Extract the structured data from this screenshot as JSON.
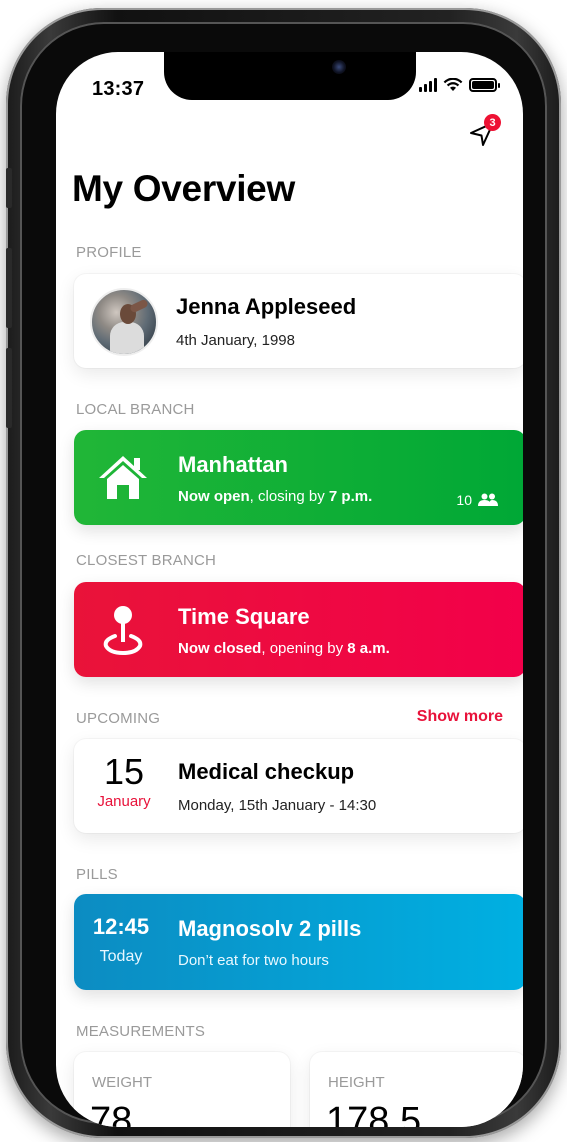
{
  "status_bar": {
    "time": "13:37"
  },
  "notifications": {
    "badge_count": "3"
  },
  "page": {
    "title": "My Overview"
  },
  "sections": {
    "profile": "PROFILE",
    "local_branch": "LOCAL BRANCH",
    "closest_branch": "CLOSEST BRANCH",
    "upcoming": "UPCOMING",
    "upcoming_action": "Show more",
    "pills": "PILLS",
    "measurements": "MEASUREMENTS"
  },
  "profile": {
    "name": "Jenna Appleseed",
    "birthdate": "4th January, 1998"
  },
  "local_branch": {
    "name": "Manhattan",
    "status_bold": "Now open",
    "status_mid": ", closing by ",
    "status_time": "7 p.m.",
    "visitors": "10",
    "color_start": "#1fb534",
    "color_end": "#00a834"
  },
  "closest_branch": {
    "name": "Time Square",
    "status_bold": "Now closed",
    "status_mid": ", opening by ",
    "status_time": "8 a.m.",
    "color_start": "#e8123a",
    "color_end": "#f10048"
  },
  "upcoming": {
    "day": "15",
    "month": "January",
    "title": "Medical checkup",
    "detail": "Monday, 15th January - 14:30"
  },
  "pills": {
    "time": "12:45",
    "day": "Today",
    "title": "Magnosolv 2 pills",
    "note": "Don’t eat for two hours",
    "color_start": "#0d8fc4",
    "color_end": "#00aee0"
  },
  "measurements": {
    "weight_label": "WEIGHT",
    "weight_value": "78",
    "height_label": "HEIGHT",
    "height_value": "178.5"
  },
  "icons": {
    "notification": "paper-plane-icon",
    "home": "house-icon",
    "location": "map-pin-icon",
    "people": "people-icon"
  }
}
